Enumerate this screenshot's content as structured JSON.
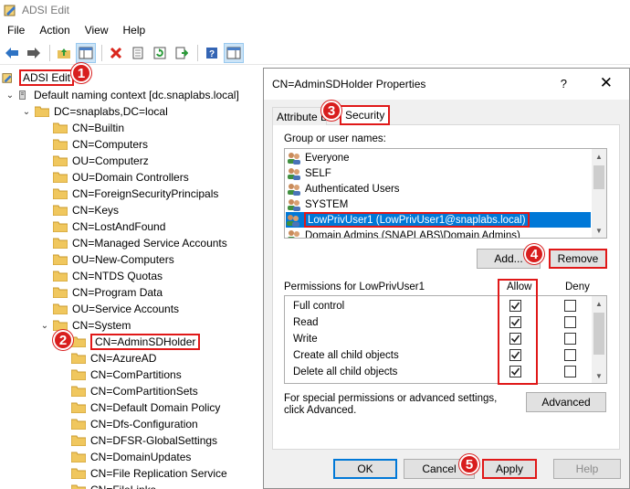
{
  "window": {
    "title": "ADSI Edit"
  },
  "menu": {
    "items": [
      "File",
      "Action",
      "View",
      "Help"
    ]
  },
  "toolbar": {
    "buttons": [
      "back-arrow-icon",
      "forward-arrow-icon",
      "folder-up-icon",
      "show-hide-tree-icon",
      "delete-icon",
      "properties-icon",
      "refresh-icon",
      "export-list-icon",
      "help-icon",
      "show-action-pane-icon"
    ]
  },
  "tree": {
    "root": "ADSI Edit",
    "naming_context": "Default naming context [dc.snaplabs.local]",
    "domain": "DC=snaplabs,DC=local",
    "children": [
      "CN=Builtin",
      "CN=Computers",
      "OU=Computerz",
      "OU=Domain Controllers",
      "CN=ForeignSecurityPrincipals",
      "CN=Keys",
      "CN=LostAndFound",
      "CN=Managed Service Accounts",
      "OU=New-Computers",
      "CN=NTDS Quotas",
      "CN=Program Data",
      "OU=Service Accounts"
    ],
    "system": "CN=System",
    "system_children": [
      "CN=AdminSDHolder",
      "CN=AzureAD",
      "CN=ComPartitions",
      "CN=ComPartitionSets",
      "CN=Default Domain Policy",
      "CN=Dfs-Configuration",
      "CN=DFSR-GlobalSettings",
      "CN=DomainUpdates",
      "CN=File Replication Service",
      "CN=FileLinks"
    ]
  },
  "dialog": {
    "title": "CN=AdminSDHolder Properties",
    "help": "?",
    "close": "✕",
    "tabs": [
      "Attribute Editor",
      "Security"
    ],
    "group_label": "Group or user names:",
    "users": [
      "Everyone",
      "SELF",
      "Authenticated Users",
      "SYSTEM",
      "LowPrivUser1 (LowPrivUser1@snaplabs.local)",
      "Domain Admins (SNAPLABS\\Domain Admins)"
    ],
    "add_button": "Add...",
    "remove_button": "Remove",
    "permissions_label": "Permissions for LowPrivUser1",
    "allow_header": "Allow",
    "deny_header": "Deny",
    "permissions": [
      {
        "name": "Full control",
        "allow": true,
        "deny": false
      },
      {
        "name": "Read",
        "allow": true,
        "deny": false
      },
      {
        "name": "Write",
        "allow": true,
        "deny": false
      },
      {
        "name": "Create all child objects",
        "allow": true,
        "deny": false
      },
      {
        "name": "Delete all child objects",
        "allow": true,
        "deny": false
      }
    ],
    "special_text": "For special permissions or advanced settings, click Advanced.",
    "advanced_button": "Advanced",
    "ok_button": "OK",
    "cancel_button": "Cancel",
    "apply_button": "Apply",
    "help_button": "Help"
  },
  "callouts": [
    "1",
    "2",
    "3",
    "4",
    "5"
  ],
  "colors": {
    "callout": "#d81e1e",
    "selection": "#0078d7"
  }
}
